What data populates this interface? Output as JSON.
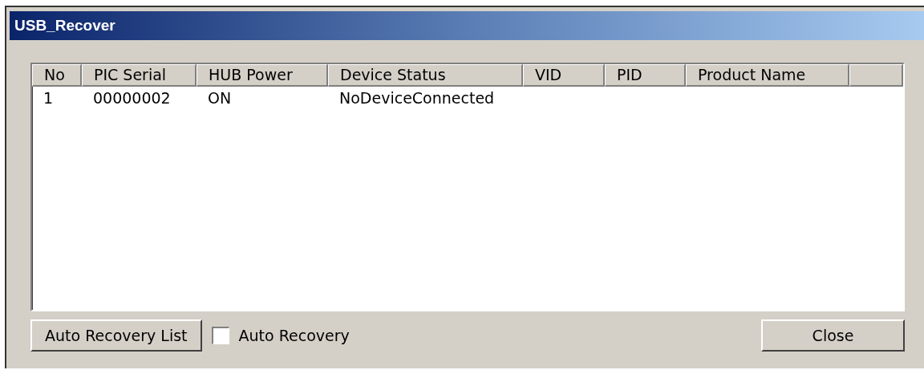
{
  "window": {
    "title": "USB_Recover"
  },
  "table": {
    "columns": [
      "No",
      "PIC Serial",
      "HUB Power",
      "Device Status",
      "VID",
      "PID",
      "Product Name"
    ],
    "rows": [
      {
        "cells": [
          "1",
          "00000002",
          "ON",
          "NoDeviceConnected",
          "",
          "",
          ""
        ]
      }
    ]
  },
  "buttons": [
    {
      "label": "Auto Recovery List"
    }
  ],
  "checkbox": {
    "label": "Auto Recovery",
    "checked": false
  },
  "close_button": {
    "label": "Close"
  }
}
